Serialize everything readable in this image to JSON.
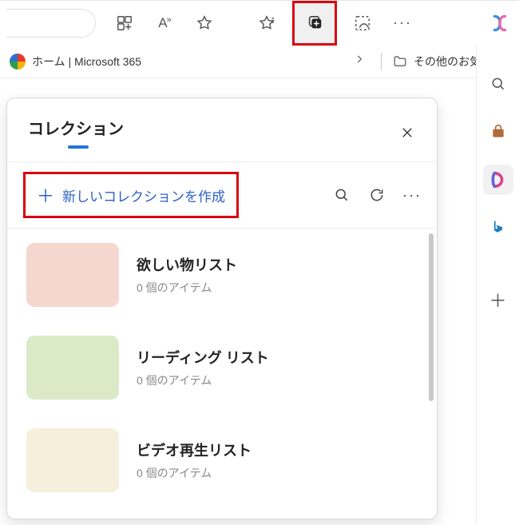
{
  "toolbar": {
    "icons": {
      "extensions": "extensions",
      "readaloud": "read-aloud",
      "star": "favorites-star",
      "favlist": "favorites-list",
      "collections": "collections",
      "screenshot": "web-capture",
      "more": "more"
    }
  },
  "bookmarks": {
    "home_label": "ホーム | Microsoft 365",
    "other_label": "その他のお気に入り"
  },
  "sidebar": {
    "search": "search",
    "shopping": "shopping",
    "m365": "microsoft-365",
    "bing": "bing",
    "add": "add"
  },
  "panel": {
    "title": "コレクション",
    "new_label": "新しいコレクションを作成",
    "items": [
      {
        "name": "欲しい物リスト",
        "count": "0 個のアイテム",
        "color": "pink"
      },
      {
        "name": "リーディング リスト",
        "count": "0 個のアイテム",
        "color": "green"
      },
      {
        "name": "ビデオ再生リスト",
        "count": "0 個のアイテム",
        "color": "cream"
      }
    ]
  }
}
